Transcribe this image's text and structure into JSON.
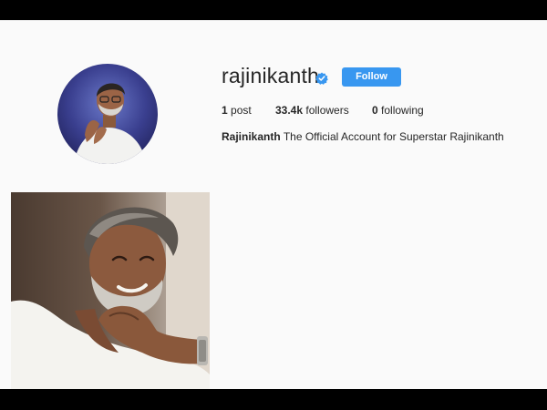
{
  "profile": {
    "username": "rajinikanth",
    "verified": true,
    "follow_label": "Follow",
    "posts_count": "1",
    "posts_label": "post",
    "followers_count": "33.4k",
    "followers_label": "followers",
    "following_count": "0",
    "following_label": "following",
    "full_name": "Rajinikanth",
    "bio": "The Official Account for Superstar Rajinikanth"
  },
  "colors": {
    "accent": "#3897f0",
    "background": "#fafafa",
    "text": "#262626"
  },
  "icons": {
    "verified": "verified-badge-icon"
  }
}
